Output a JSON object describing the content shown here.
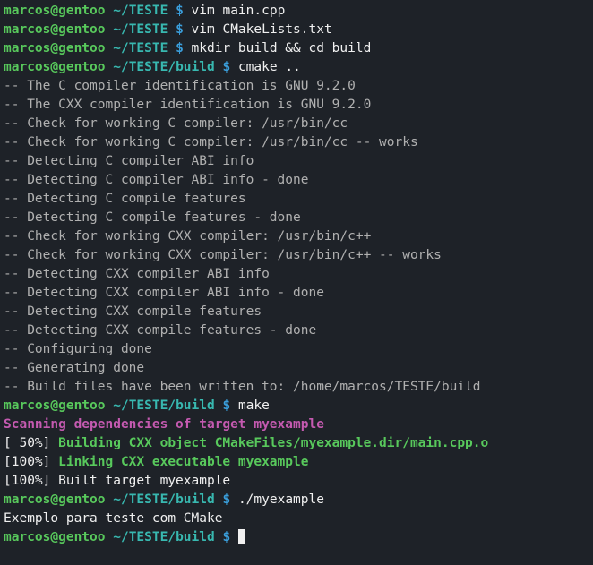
{
  "prompt": {
    "user": "marcos@gentoo",
    "path1": "~/TESTE",
    "path2": "~/TESTE/build",
    "symbol": "$"
  },
  "cmds": {
    "c1": "vim main.cpp",
    "c2": "vim CMakeLists.txt",
    "c3": "mkdir build && cd build",
    "c4": "cmake ..",
    "c5": "make",
    "c6": "./myexample",
    "c7": ""
  },
  "out": {
    "l1": "-- The C compiler identification is GNU 9.2.0",
    "l2": "-- The CXX compiler identification is GNU 9.2.0",
    "l3": "-- Check for working C compiler: /usr/bin/cc",
    "l4": "-- Check for working C compiler: /usr/bin/cc -- works",
    "l5": "-- Detecting C compiler ABI info",
    "l6": "-- Detecting C compiler ABI info - done",
    "l7": "-- Detecting C compile features",
    "l8": "-- Detecting C compile features - done",
    "l9": "-- Check for working CXX compiler: /usr/bin/c++",
    "l10": "-- Check for working CXX compiler: /usr/bin/c++ -- works",
    "l11": "-- Detecting CXX compiler ABI info",
    "l12": "-- Detecting CXX compiler ABI info - done",
    "l13": "-- Detecting CXX compile features",
    "l14": "-- Detecting CXX compile features - done",
    "l15": "-- Configuring done",
    "l16": "-- Generating done",
    "l17": "-- Build files have been written to: /home/marcos/TESTE/build",
    "scan": "Scanning dependencies of target myexample",
    "pct50": "[ 50%] ",
    "build_cxx": "Building CXX object CMakeFiles/myexample.dir/main.cpp.o",
    "pct100a": "[100%] ",
    "link_cxx": "Linking CXX executable myexample",
    "built": "[100%] Built target myexample",
    "runout": "Exemplo para teste com CMake"
  }
}
